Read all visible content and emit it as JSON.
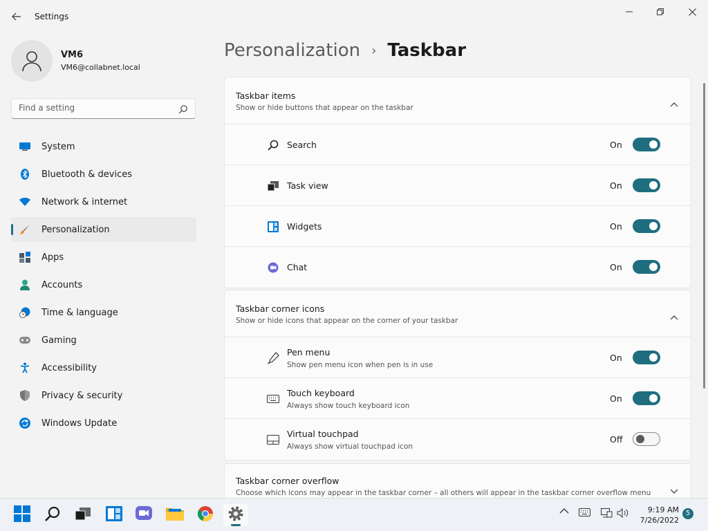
{
  "window": {
    "title": "Settings"
  },
  "profile": {
    "name": "VM6",
    "email": "VM6@collabnet.local"
  },
  "search": {
    "placeholder": "Find a setting"
  },
  "nav": [
    {
      "label": "System",
      "icon": "system-icon"
    },
    {
      "label": "Bluetooth & devices",
      "icon": "bluetooth-icon"
    },
    {
      "label": "Network & internet",
      "icon": "wifi-icon"
    },
    {
      "label": "Personalization",
      "icon": "brush-icon",
      "active": true
    },
    {
      "label": "Apps",
      "icon": "apps-icon"
    },
    {
      "label": "Accounts",
      "icon": "person-icon"
    },
    {
      "label": "Time & language",
      "icon": "clock-globe-icon"
    },
    {
      "label": "Gaming",
      "icon": "gamepad-icon"
    },
    {
      "label": "Accessibility",
      "icon": "accessibility-icon"
    },
    {
      "label": "Privacy & security",
      "icon": "shield-icon"
    },
    {
      "label": "Windows Update",
      "icon": "update-icon"
    }
  ],
  "breadcrumb": {
    "parent": "Personalization",
    "separator": "›",
    "current": "Taskbar"
  },
  "sections": {
    "items": {
      "title": "Taskbar items",
      "desc": "Show or hide buttons that appear on the taskbar",
      "rows": [
        {
          "label": "Search",
          "state": "On",
          "on": true
        },
        {
          "label": "Task view",
          "state": "On",
          "on": true
        },
        {
          "label": "Widgets",
          "state": "On",
          "on": true
        },
        {
          "label": "Chat",
          "state": "On",
          "on": true
        }
      ]
    },
    "corner": {
      "title": "Taskbar corner icons",
      "desc": "Show or hide icons that appear on the corner of your taskbar",
      "rows": [
        {
          "label": "Pen menu",
          "sub": "Show pen menu icon when pen is in use",
          "state": "On",
          "on": true
        },
        {
          "label": "Touch keyboard",
          "sub": "Always show touch keyboard icon",
          "state": "On",
          "on": true
        },
        {
          "label": "Virtual touchpad",
          "sub": "Always show virtual touchpad icon",
          "state": "Off",
          "on": false
        }
      ]
    },
    "overflow": {
      "title": "Taskbar corner overflow",
      "desc": "Choose which icons may appear in the taskbar corner – all others will appear in the taskbar corner overflow menu"
    }
  },
  "taskbar": {
    "time": "9:19 AM",
    "date": "7/26/2022",
    "notifications": "5"
  },
  "colors": {
    "accent": "#1f6e7f",
    "background": "#f3f3f3",
    "card": "#fbfbfb"
  }
}
